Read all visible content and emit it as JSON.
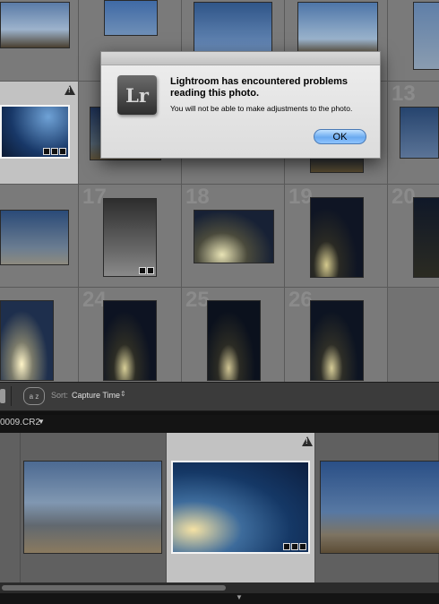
{
  "grid": {
    "cell_numbers": [
      "17",
      "18",
      "19",
      "20",
      "24",
      "25",
      "26",
      "13"
    ],
    "warning_icon": "warning-triangle-icon"
  },
  "dialog": {
    "app_icon_text": "Lr",
    "title": "Lightroom has encountered problems reading this photo.",
    "message": "You will not be able to make adjustments to the photo.",
    "ok_label": "OK"
  },
  "toolbar": {
    "sort_icon_text": "a z",
    "sort_label": "Sort:",
    "sort_value": "Capture Time"
  },
  "filmstrip": {
    "filename": "0009.CR2"
  },
  "colors": {
    "accent_button": "#6aaaf0",
    "selection": "#c2c2c2"
  }
}
